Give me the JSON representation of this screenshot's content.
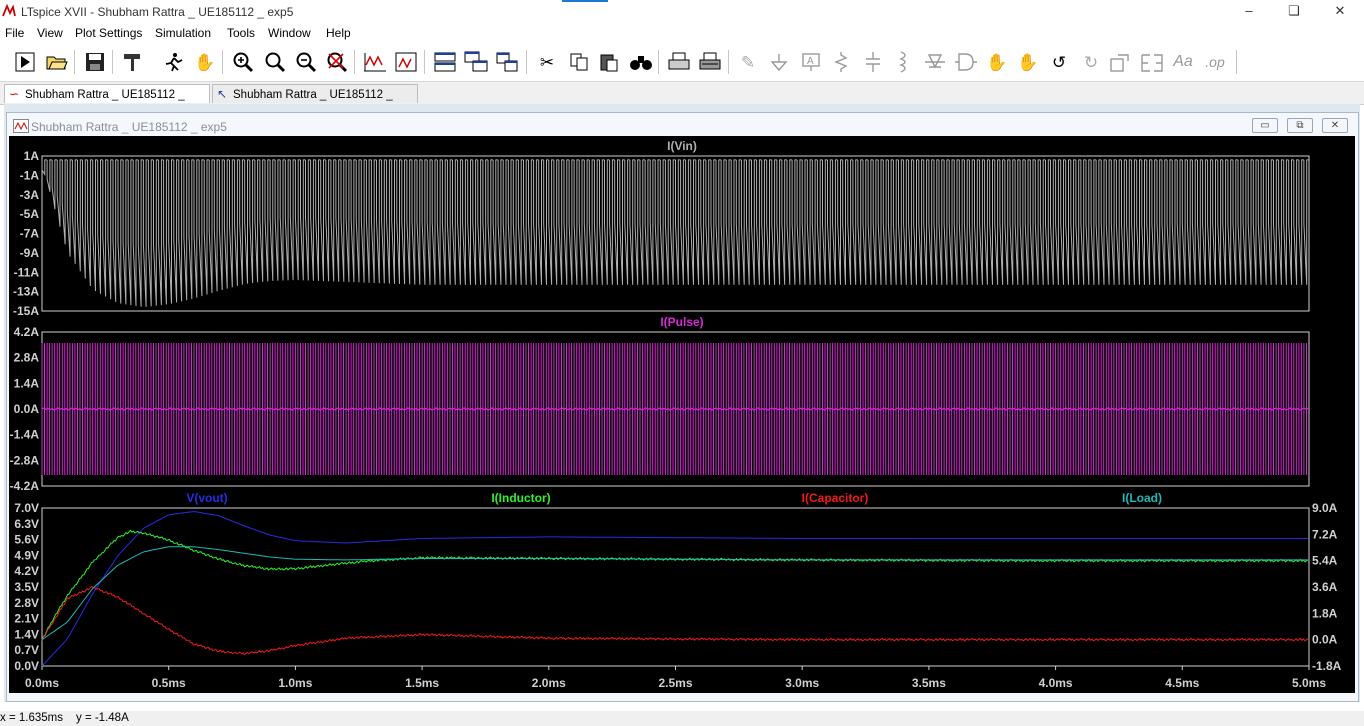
{
  "window": {
    "title": "LTspice XVII - Shubham Rattra _ UE185112 _ exp5"
  },
  "menu": [
    "File",
    "View",
    "Plot Settings",
    "Simulation",
    "Tools",
    "Window",
    "Help"
  ],
  "toolbar": {
    "buttons": [
      "run",
      "open",
      "save",
      "control-panel",
      "run-halt",
      "pan",
      "zoom-in",
      "zoom-area",
      "zoom-out",
      "zoom-cancel",
      "autorange",
      "mark-text",
      "tile-horizontal",
      "cascade",
      "tile-windows",
      "cut",
      "copy",
      "paste",
      "find",
      "print",
      "print-setup",
      "wire",
      "ground",
      "label",
      "resistor",
      "capacitor",
      "inductor",
      "diode",
      "component",
      "move",
      "drag",
      "undo",
      "redo",
      "rotate",
      "mirror",
      "text",
      "spice-directive"
    ]
  },
  "tabs": [
    "Shubham Rattra _ UE185112 _ exp5",
    "Shubham Rattra _ UE185112 _ exp5"
  ],
  "subwindow": {
    "title": "Shubham Rattra _ UE185112 _ exp5",
    "minimize": "▭",
    "restore": "⧉",
    "close": "✕"
  },
  "status": {
    "x": "x = 1.635ms",
    "y": "y = -1.48A"
  },
  "colors": {
    "vin": "#b0b0b0",
    "pulse": "#d629d6",
    "vout": "#2a2ae6",
    "inductor": "#2cf22c",
    "capacitor": "#f21a1a",
    "load": "#20b8b8",
    "axis": "#d0d0d0",
    "plot_bg": "#000000"
  },
  "chart_data": [
    {
      "type": "line",
      "title": "I(Vin)",
      "x_unit": "ms",
      "xlim": [
        0,
        5
      ],
      "ylim": [
        -15,
        1
      ],
      "yticks": [
        "1A",
        "-1A",
        "-3A",
        "-5A",
        "-7A",
        "-9A",
        "-11A",
        "-13A",
        "-15A"
      ],
      "series": [
        {
          "name": "I(Vin)",
          "x": [
            0,
            0.1,
            0.2,
            0.3,
            0.4,
            0.5,
            0.6,
            0.7,
            0.8,
            0.9,
            1.0,
            1.2,
            1.5,
            2.0,
            3.0,
            4.0,
            5.0
          ],
          "upper": [
            0.6,
            0.6,
            0.6,
            0.6,
            0.6,
            0.6,
            0.6,
            0.6,
            0.6,
            0.6,
            0.6,
            0.6,
            0.6,
            0.6,
            0.6,
            0.6,
            0.6
          ],
          "lower_envelope": [
            0.0,
            -9.0,
            -12.8,
            -14.2,
            -14.6,
            -14.3,
            -13.7,
            -12.9,
            -12.2,
            -11.9,
            -11.8,
            -12.0,
            -12.3,
            -12.3,
            -12.3,
            -12.3,
            -12.3
          ],
          "mid_envelope": [
            0.0,
            -4.5,
            -6.8,
            -7.9,
            -8.2,
            -8.0,
            -7.2,
            -6.5,
            -5.9,
            -5.4,
            -5.3,
            -5.4,
            -5.8,
            -6.0,
            -6.0,
            -6.0,
            -6.0
          ]
        }
      ]
    },
    {
      "type": "line",
      "title": "I(Pulse)",
      "x_unit": "ms",
      "xlim": [
        0,
        5
      ],
      "ylim": [
        -4.2,
        4.2
      ],
      "yticks": [
        "4.2A",
        "2.8A",
        "1.4A",
        "0.0A",
        "-1.4A",
        "-2.8A",
        "-4.2A"
      ],
      "series": [
        {
          "name": "I(Pulse)",
          "x": [
            0,
            5
          ],
          "upper": [
            3.6,
            3.6
          ],
          "lower": [
            -3.6,
            -3.6
          ],
          "mean": [
            0.0,
            0.0
          ]
        }
      ]
    },
    {
      "type": "line",
      "x_unit": "ms",
      "xlim": [
        0,
        5
      ],
      "xticks": [
        "0.0ms",
        "0.5ms",
        "1.0ms",
        "1.5ms",
        "2.0ms",
        "2.5ms",
        "3.0ms",
        "3.5ms",
        "4.0ms",
        "4.5ms",
        "5.0ms"
      ],
      "ylim_left": [
        0,
        7
      ],
      "yticks_left": [
        "7.0V",
        "6.3V",
        "5.6V",
        "4.9V",
        "4.2V",
        "3.5V",
        "2.8V",
        "2.1V",
        "1.4V",
        "0.7V",
        "0.0V"
      ],
      "ylim_right": [
        -1.8,
        9.0
      ],
      "yticks_right": [
        "9.0A",
        "7.2A",
        "5.4A",
        "3.6A",
        "1.8A",
        "0.0A",
        "-1.8A"
      ],
      "series": [
        {
          "name": "V(vout)",
          "axis": "left",
          "x": [
            0,
            0.1,
            0.2,
            0.3,
            0.4,
            0.5,
            0.6,
            0.7,
            0.8,
            0.9,
            1.0,
            1.2,
            1.5,
            2.0,
            3.0,
            4.0,
            5.0
          ],
          "y": [
            0.0,
            1.2,
            3.2,
            4.9,
            6.1,
            6.7,
            6.85,
            6.65,
            6.2,
            5.8,
            5.55,
            5.45,
            5.65,
            5.72,
            5.65,
            5.65,
            5.65
          ]
        },
        {
          "name": "I(Inductor)",
          "axis": "right",
          "x": [
            0,
            0.05,
            0.1,
            0.2,
            0.3,
            0.35,
            0.4,
            0.5,
            0.6,
            0.7,
            0.8,
            0.9,
            1.0,
            1.1,
            1.3,
            1.5,
            2.0,
            3.0,
            4.0,
            5.0
          ],
          "y": [
            0.0,
            1.6,
            3.0,
            5.3,
            7.0,
            7.4,
            7.3,
            6.8,
            6.1,
            5.5,
            5.05,
            4.82,
            4.85,
            5.05,
            5.4,
            5.6,
            5.55,
            5.45,
            5.4,
            5.4
          ]
        },
        {
          "name": "I(Capacitor)",
          "axis": "right",
          "x": [
            0,
            0.1,
            0.2,
            0.3,
            0.4,
            0.5,
            0.6,
            0.7,
            0.8,
            0.9,
            1.0,
            1.2,
            1.5,
            2.0,
            3.0,
            4.0,
            5.0
          ],
          "y": [
            0.0,
            2.8,
            3.6,
            2.9,
            1.8,
            0.7,
            -0.3,
            -0.8,
            -0.95,
            -0.75,
            -0.4,
            0.1,
            0.35,
            0.1,
            0.0,
            0.0,
            0.0
          ]
        },
        {
          "name": "I(Load)",
          "axis": "right",
          "x": [
            0,
            0.1,
            0.2,
            0.3,
            0.4,
            0.5,
            0.6,
            0.7,
            0.8,
            0.9,
            1.0,
            1.2,
            1.5,
            2.0,
            3.0,
            4.0,
            5.0
          ],
          "y": [
            0.0,
            1.2,
            3.5,
            5.1,
            6.0,
            6.35,
            6.35,
            6.15,
            5.9,
            5.65,
            5.5,
            5.45,
            5.55,
            5.55,
            5.45,
            5.45,
            5.45
          ]
        }
      ]
    }
  ]
}
